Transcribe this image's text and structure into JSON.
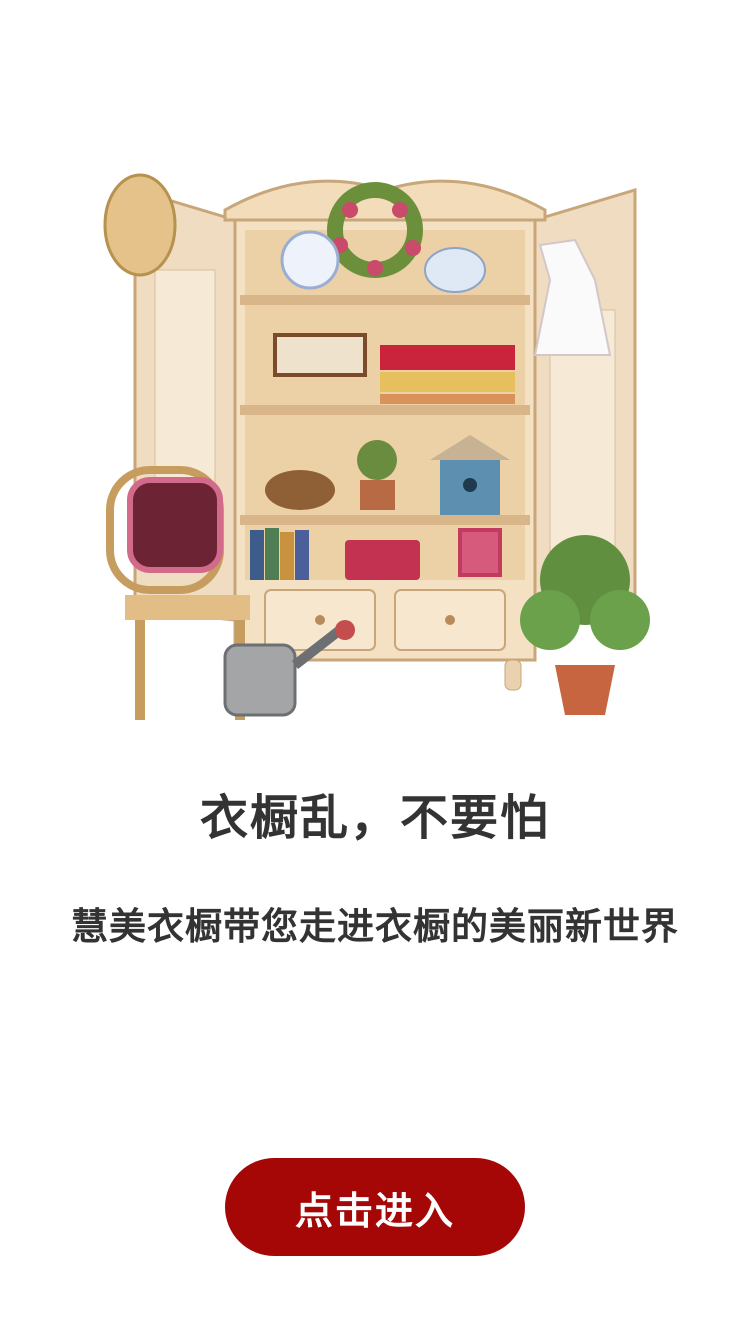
{
  "hero": {
    "image_name": "wardrobe-illustration",
    "title": "衣橱乱，不要怕",
    "subtitle": "慧美衣橱带您走进衣橱的美丽新世界"
  },
  "actions": {
    "enter_label": "点击进入"
  },
  "colors": {
    "button": "#a40706",
    "text": "#333333",
    "background": "#ffffff"
  }
}
